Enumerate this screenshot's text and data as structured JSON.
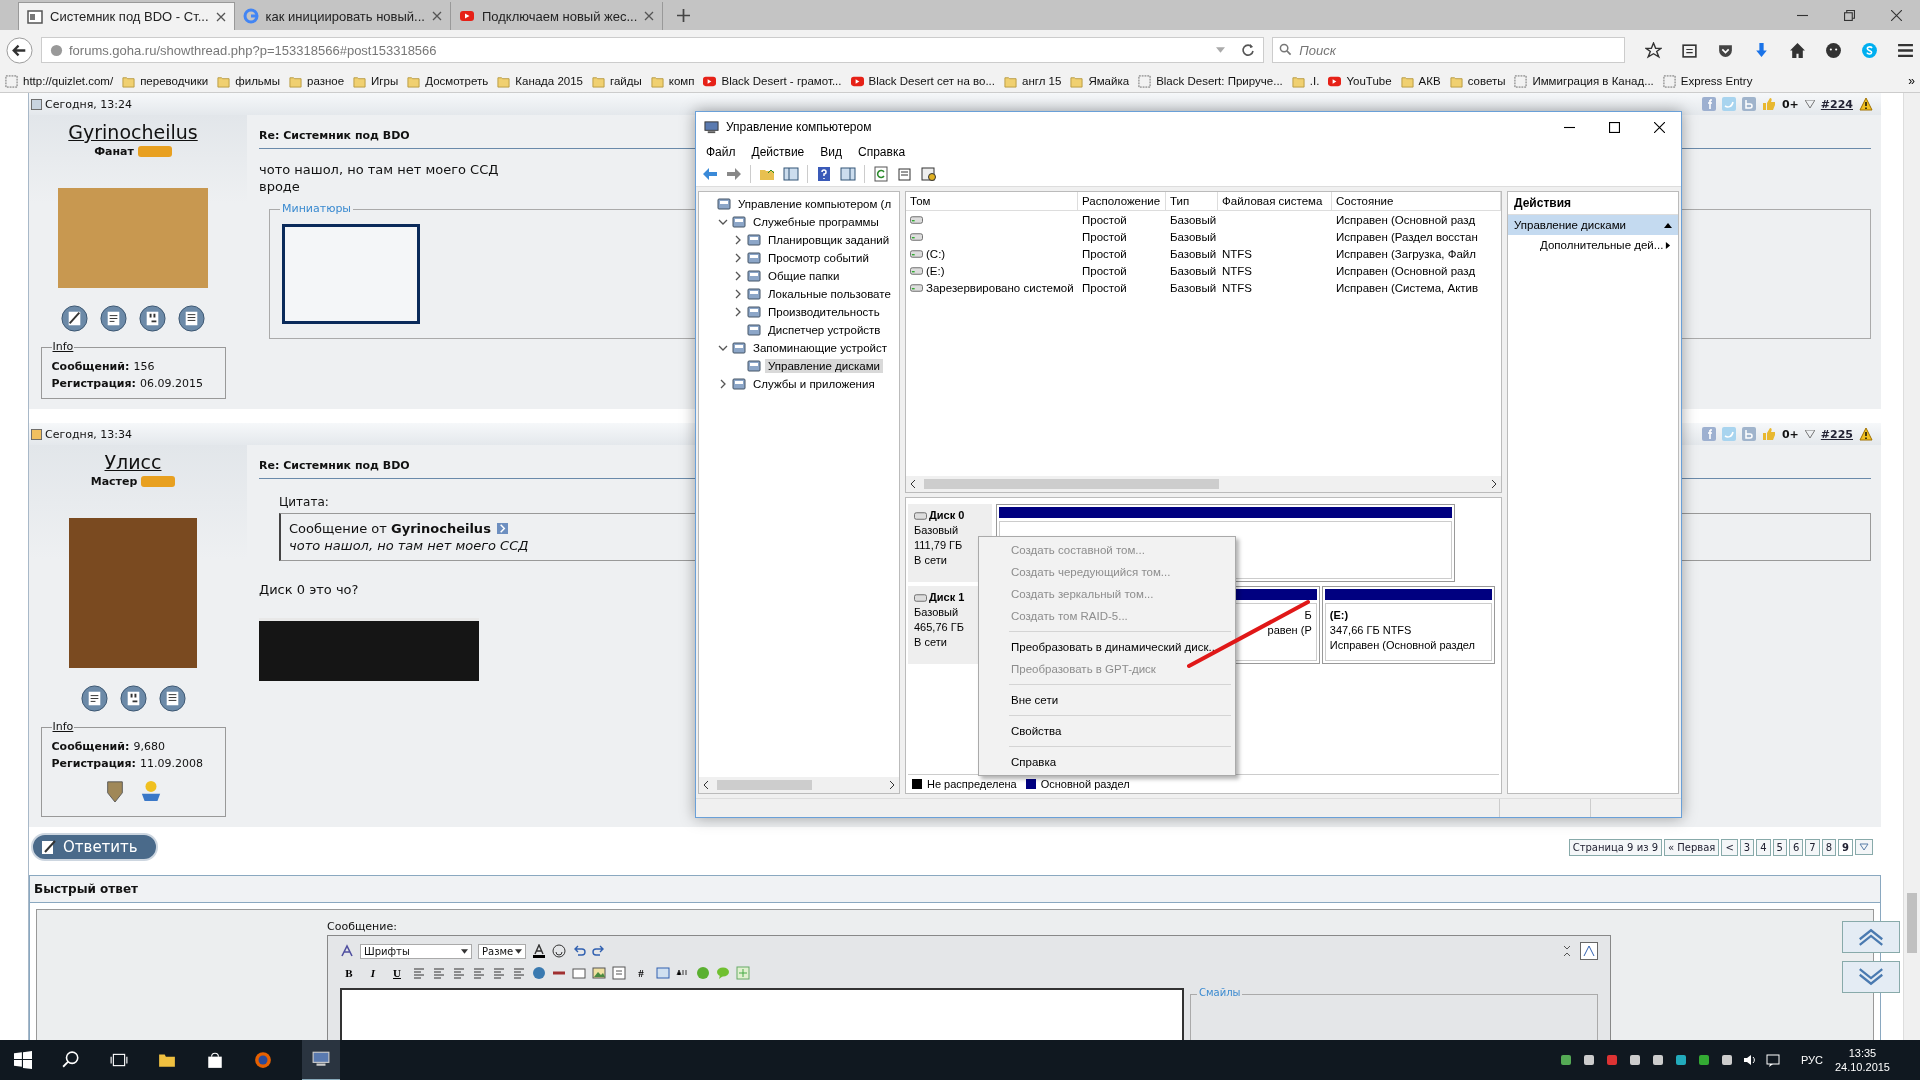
{
  "browser": {
    "tabs": [
      {
        "title": "Системник под BDO - Ст...",
        "selected": true,
        "kind": "page"
      },
      {
        "title": "как инициировать новый...",
        "selected": false,
        "kind": "google"
      },
      {
        "title": "Подключаем новый жес...",
        "selected": false,
        "kind": "youtube"
      }
    ],
    "url": "forums.goha.ru/showthread.php?p=153318566#post153318566",
    "search_placeholder": "Поиск",
    "bookmarks": [
      {
        "label": "http://quizlet.com/",
        "kind": "page"
      },
      {
        "label": "переводчики",
        "kind": "folder"
      },
      {
        "label": "фильмы",
        "kind": "folder"
      },
      {
        "label": "разное",
        "kind": "folder"
      },
      {
        "label": "Игры",
        "kind": "folder"
      },
      {
        "label": "Досмотреть",
        "kind": "folder"
      },
      {
        "label": "Канада 2015",
        "kind": "folder"
      },
      {
        "label": "гайды",
        "kind": "folder"
      },
      {
        "label": "комп",
        "kind": "folder"
      },
      {
        "label": "Black Desert - грамот...",
        "kind": "youtube"
      },
      {
        "label": "Black Desert сет на во...",
        "kind": "youtube"
      },
      {
        "label": "англ 15",
        "kind": "folder"
      },
      {
        "label": "Ямайка",
        "kind": "folder"
      },
      {
        "label": "Black Desert: Приручe...",
        "kind": "page"
      },
      {
        "label": ".I.",
        "kind": "folder"
      },
      {
        "label": "YouTube",
        "kind": "youtube"
      },
      {
        "label": "АКВ",
        "kind": "folder"
      },
      {
        "label": "советы",
        "kind": "folder"
      },
      {
        "label": "Иммиграция в Канад...",
        "kind": "page"
      },
      {
        "label": "Express Entry",
        "kind": "page"
      }
    ],
    "bookmarks_overflow": "»"
  },
  "posts": [
    {
      "time": "Сегодня, 13:24",
      "rating": "0+",
      "number": "#224",
      "username": "Gyrinocheilus",
      "rank": "Фанат",
      "title": "Re: Системник под BDO",
      "body": [
        "чото нашол, но там нет моего ССД",
        "вроде"
      ],
      "attachments_legend": "Миниатюры",
      "editable": true,
      "info": {
        "legend": "Info",
        "fields": [
          {
            "label": "Сообщений:",
            "value": "156"
          },
          {
            "label": "Регистрация:",
            "value": "06.09.2015"
          }
        ]
      }
    },
    {
      "time": "Сегодня, 13:34",
      "rating": "0+",
      "number": "#225",
      "username": "Улисс",
      "rank": "Мастер",
      "title": "Re: Системник под BDO",
      "quote": {
        "label": "Цитата:",
        "from": "Сообщение от **Gyrinocheilus**",
        "text": "чото нашол, но там нет моего ССД"
      },
      "body": [
        "Диск 0 это чо?"
      ],
      "banner": true,
      "info": {
        "legend": "Info",
        "fields": [
          {
            "label": "Сообщений:",
            "value": "9,680"
          },
          {
            "label": "Регистрация:",
            "value": "11.09.2008"
          }
        ]
      },
      "awards_shown": true
    }
  ],
  "reply_button": "Ответить",
  "pagination": {
    "summary": "Страница 9 из 9",
    "first": "« Первая",
    "prev": "<",
    "pages": [
      {
        "label": "3",
        "selected": false
      },
      {
        "label": "4",
        "selected": false
      },
      {
        "label": "5",
        "selected": false
      },
      {
        "label": "6",
        "selected": false
      },
      {
        "label": "7",
        "selected": false
      },
      {
        "label": "8",
        "selected": false
      },
      {
        "label": "9",
        "selected": true
      }
    ]
  },
  "quick_reply": {
    "title": "Быстрый ответ",
    "message_label": "Сообщение:",
    "font_select": "Шрифты",
    "size_select": "Разме",
    "format_buttons": [
      "B",
      "I",
      "U"
    ],
    "hash_button": "#",
    "smilies_legend": "Смайлы"
  },
  "mmc": {
    "title": "Управление компьютером",
    "menu": [
      "Файл",
      "Действие",
      "Вид",
      "Справка"
    ],
    "tree": [
      {
        "label": "Управление компьютером (л",
        "selected": false,
        "children": [
          {
            "label": "Служебные программы",
            "selected": false,
            "expanded": true,
            "children": [
              {
                "label": "Планировщик заданий",
                "selected": false,
                "expanded": false
              },
              {
                "label": "Просмотр событий",
                "selected": false,
                "expanded": false
              },
              {
                "label": "Общие папки",
                "selected": false,
                "expanded": false
              },
              {
                "label": "Локальные пользовате",
                "selected": false,
                "expanded": false
              },
              {
                "label": "Производительность",
                "selected": false,
                "expanded": false
              },
              {
                "label": "Диспетчер устройств",
                "selected": false
              }
            ]
          },
          {
            "label": "Запоминающие устройст",
            "selected": false,
            "expanded": true,
            "children": [
              {
                "label": "Управление дисками",
                "selected": true
              }
            ]
          },
          {
            "label": "Службы и приложения",
            "selected": false,
            "expanded": false
          }
        ]
      }
    ],
    "columns": [
      "Том",
      "Расположение",
      "Тип",
      "Файловая система",
      "Состояние"
    ],
    "volumes": [
      {
        "layout": "Простой",
        "type": "Базовый",
        "status": "Исправен (Основной разд"
      },
      {
        "layout": "Простой",
        "type": "Базовый",
        "status": "Исправен (Раздел восстан"
      },
      {
        "name": "(C:)",
        "layout": "Простой",
        "type": "Базовый",
        "fs": "NTFS",
        "status": "Исправен (Загрузка, Файл"
      },
      {
        "name": "(E:)",
        "layout": "Простой",
        "type": "Базовый",
        "fs": "NTFS",
        "status": "Исправен (Основной разд"
      },
      {
        "name": "Зарезервировано системой",
        "layout": "Простой",
        "type": "Базовый",
        "fs": "NTFS",
        "status": "Исправен (Система, Актив"
      }
    ],
    "disks": [
      {
        "name": "Диск 0",
        "type": "Базовый",
        "size": "111,79 ГБ",
        "status": "В сети",
        "partitions": [
          {
            "color": "#000080"
          }
        ]
      },
      {
        "name": "Диск 1",
        "type": "Базовый",
        "size": "465,76 ГБ",
        "status": "В сети",
        "partitions": [
          {
            "color": "#000080",
            "lines": [
              "Б",
              "равен (Р"
            ]
          },
          {
            "color": "#000080",
            "label": "(E:)",
            "lines": [
              "347,66 ГБ NTFS",
              "Исправен (Основной раздел"
            ]
          }
        ]
      }
    ],
    "legend": [
      {
        "label": "Не распределена",
        "color": "#000000"
      },
      {
        "label": "Основной раздел",
        "color": "#000080"
      }
    ],
    "context_menu": [
      {
        "kind": "item",
        "label": "Создать составной том...",
        "disabled": true
      },
      {
        "kind": "item",
        "label": "Создать чередующийся том...",
        "disabled": true
      },
      {
        "kind": "item",
        "label": "Создать зеркальный том...",
        "disabled": true
      },
      {
        "kind": "item",
        "label": "Создать том RAID-5...",
        "disabled": true
      },
      {
        "kind": "separator"
      },
      {
        "kind": "item",
        "label": "Преобразовать в динамический диск...",
        "disabled": false
      },
      {
        "kind": "item",
        "label": "Преобразовать в GPT-диск",
        "disabled": true
      },
      {
        "kind": "separator"
      },
      {
        "kind": "item",
        "label": "Вне сети",
        "disabled": false
      },
      {
        "kind": "separator"
      },
      {
        "kind": "item",
        "label": "Свойства",
        "disabled": false
      },
      {
        "kind": "separator"
      },
      {
        "kind": "item",
        "label": "Справка",
        "disabled": false
      }
    ],
    "actions": {
      "title": "Действия",
      "items": [
        {
          "kind": "header",
          "label": "Управление дисками",
          "selected": true
        },
        {
          "kind": "submenu",
          "label": "Дополнительные дей...",
          "selected": false
        }
      ]
    }
  },
  "taskbar": {
    "language": "РУС",
    "time": "13:35",
    "date": "24.10.2015"
  }
}
